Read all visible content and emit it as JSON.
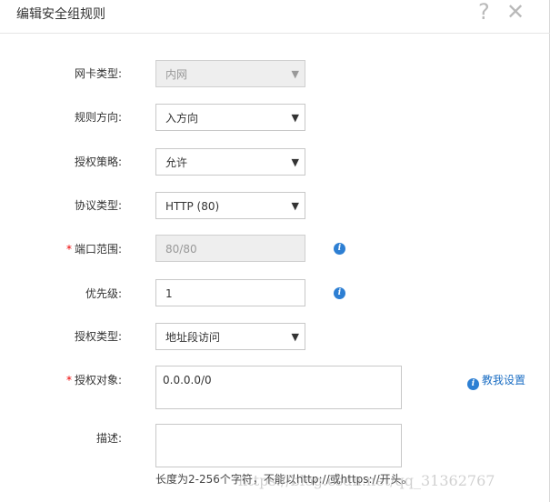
{
  "dialog": {
    "title": "编辑安全组规则",
    "help_symbol": "?",
    "close_symbol": "✕"
  },
  "form": {
    "nic_type": {
      "label": "网卡类型:",
      "value": "内网",
      "disabled": true
    },
    "direction": {
      "label": "规则方向:",
      "value": "入方向"
    },
    "policy": {
      "label": "授权策略:",
      "value": "允许"
    },
    "protocol": {
      "label": "协议类型:",
      "value": "HTTP (80)"
    },
    "port_range": {
      "label": "端口范围:",
      "value": "80/80",
      "required": true,
      "disabled": true
    },
    "priority": {
      "label": "优先级:",
      "value": "1"
    },
    "auth_type": {
      "label": "授权类型:",
      "value": "地址段访问"
    },
    "auth_object": {
      "label": "授权对象:",
      "value": "0.0.0.0/0",
      "required": true
    },
    "description": {
      "label": "描述:",
      "value": ""
    },
    "tutorial_link": "教我设置",
    "description_hint": "长度为2-256个字符，不能以http://或https://开头。",
    "required_mark": "*",
    "info_glyph": "i",
    "dropdown_glyph": "▼"
  },
  "watermark": "https://blog.csdn.net/qq_31362767",
  "colors": {
    "accent": "#2d7fd3",
    "link": "#1d6fc4",
    "required": "#e00000",
    "disabled_bg": "#eeeeee"
  },
  "icons": [
    "help-icon",
    "close-icon",
    "info-icon",
    "dropdown-arrow-icon"
  ]
}
